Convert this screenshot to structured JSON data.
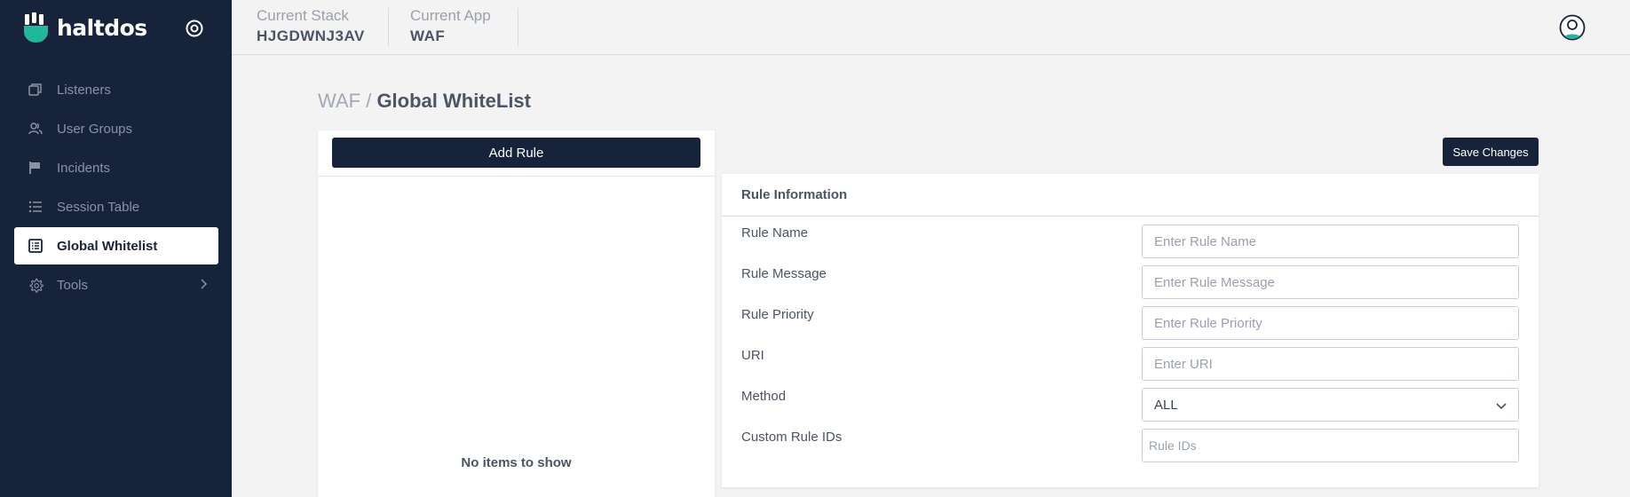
{
  "brand": {
    "name": "haltdos"
  },
  "sidebar": {
    "items": [
      {
        "label": "Listeners",
        "icon": "windows-icon"
      },
      {
        "label": "User Groups",
        "icon": "users-icon"
      },
      {
        "label": "Incidents",
        "icon": "flag-icon"
      },
      {
        "label": "Session Table",
        "icon": "list-icon"
      },
      {
        "label": "Global Whitelist",
        "icon": "table-list-icon",
        "active": true
      },
      {
        "label": "Tools",
        "icon": "gear-icon",
        "has_submenu": true
      }
    ]
  },
  "topbar": {
    "stack_label": "Current Stack",
    "stack_value": "HJGDWNJ3AV",
    "app_label": "Current App",
    "app_value": "WAF"
  },
  "breadcrumb": {
    "parent": "WAF",
    "separator": "/",
    "current": "Global WhiteList"
  },
  "list_panel": {
    "add_label": "Add Rule",
    "empty_text": "No items to show"
  },
  "save_label": "Save Changes",
  "rule_info": {
    "title": "Rule Information",
    "fields": {
      "name": {
        "label": "Rule Name",
        "placeholder": "Enter Rule Name"
      },
      "message": {
        "label": "Rule Message",
        "placeholder": "Enter Rule Message"
      },
      "priority": {
        "label": "Rule Priority",
        "placeholder": "Enter Rule Priority"
      },
      "uri": {
        "label": "URI",
        "placeholder": "Enter URI"
      },
      "method": {
        "label": "Method",
        "value": "ALL"
      },
      "custom_ids": {
        "label": "Custom Rule IDs",
        "placeholder": "Rule IDs"
      }
    }
  },
  "colors": {
    "sidebar_bg": "#17233a",
    "brand_accent": "#1fb89a",
    "page_bg": "#f2f3f2"
  }
}
